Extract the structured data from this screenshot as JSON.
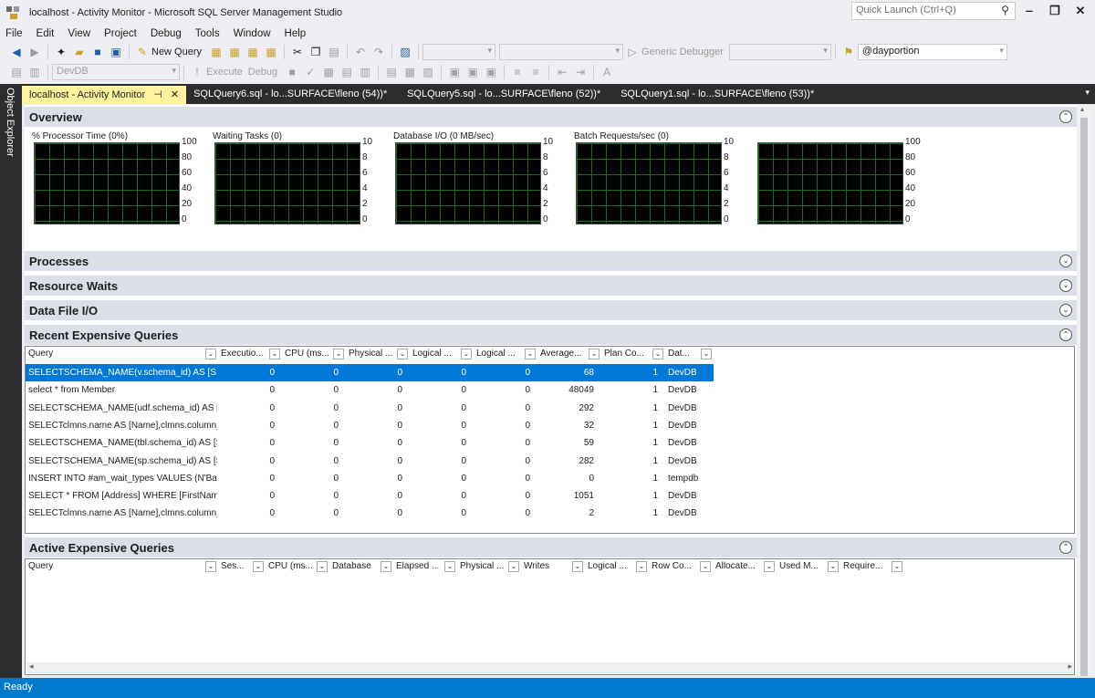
{
  "window": {
    "title": "localhost - Activity Monitor - Microsoft SQL Server Management Studio",
    "quick_launch_placeholder": "Quick Launch (Ctrl+Q)"
  },
  "menu": [
    "File",
    "Edit",
    "View",
    "Project",
    "Debug",
    "Tools",
    "Window",
    "Help"
  ],
  "toolbar1": {
    "new_query": "New Query",
    "generic_debugger": "Generic Debugger",
    "search_value": "@dayportion"
  },
  "toolbar2": {
    "database": "DevDB",
    "execute": "Execute",
    "debug": "Debug"
  },
  "left_rail": {
    "label": "Object Explorer"
  },
  "tabs": [
    {
      "label": "localhost - Activity Monitor",
      "active": true
    },
    {
      "label": "SQLQuery6.sql - lo...SURFACE\\fleno (54))*",
      "active": false
    },
    {
      "label": "SQLQuery5.sql - lo...SURFACE\\fleno (52))*",
      "active": false
    },
    {
      "label": "SQLQuery1.sql - lo...SURFACE\\fleno (53))*",
      "active": false
    }
  ],
  "sections": {
    "overview": "Overview",
    "processes": "Processes",
    "resource_waits": "Resource Waits",
    "data_file_io": "Data File I/O",
    "recent_expensive": "Recent Expensive Queries",
    "active_expensive": "Active Expensive Queries"
  },
  "graphs": [
    {
      "title": "% Processor Time (0%)",
      "ticks": [
        "100",
        "80",
        "60",
        "40",
        "20",
        "0"
      ]
    },
    {
      "title": "Waiting Tasks (0)",
      "ticks": [
        "10",
        "8",
        "6",
        "4",
        "2",
        "0"
      ]
    },
    {
      "title": "Database I/O (0 MB/sec)",
      "ticks": [
        "10",
        "8",
        "6",
        "4",
        "2",
        "0"
      ]
    },
    {
      "title": "Batch Requests/sec (0)",
      "ticks": [
        "10",
        "8",
        "6",
        "4",
        "2",
        "0"
      ]
    },
    {
      "title": "",
      "ticks": [
        "100",
        "80",
        "60",
        "40",
        "20",
        "0"
      ]
    }
  ],
  "recent_columns": [
    "Query",
    "Executio...",
    "CPU (ms...",
    "Physical ...",
    "Logical ...",
    "Logical ...",
    "Average...",
    "Plan Co...",
    "Dat..."
  ],
  "recent_rows": [
    [
      "SELECTSCHEMA_NAME(v.schema_id) AS [S...",
      "0",
      "0",
      "0",
      "0",
      "0",
      "68",
      "1",
      "DevDB"
    ],
    [
      "select * from Member",
      "0",
      "0",
      "0",
      "0",
      "0",
      "48049",
      "1",
      "DevDB"
    ],
    [
      "SELECTSCHEMA_NAME(udf.schema_id) AS [...",
      "0",
      "0",
      "0",
      "0",
      "0",
      "292",
      "1",
      "DevDB"
    ],
    [
      "SELECTclmns.name AS [Name],clmns.column_...",
      "0",
      "0",
      "0",
      "0",
      "0",
      "32",
      "1",
      "DevDB"
    ],
    [
      "SELECTSCHEMA_NAME(tbl.schema_id) AS [S...",
      "0",
      "0",
      "0",
      "0",
      "0",
      "59",
      "1",
      "DevDB"
    ],
    [
      "SELECTSCHEMA_NAME(sp.schema_id) AS [S...",
      "0",
      "0",
      "0",
      "0",
      "0",
      "282",
      "1",
      "DevDB"
    ],
    [
      "INSERT INTO #am_wait_types VALUES (N'Ba...",
      "0",
      "0",
      "0",
      "0",
      "0",
      "0",
      "1",
      "tempdb"
    ],
    [
      "SELECT * FROM [Address] WHERE [FirstNam...",
      "0",
      "0",
      "0",
      "0",
      "0",
      "1051",
      "1",
      "DevDB"
    ],
    [
      "SELECTclmns.name AS [Name],clmns.column_...",
      "0",
      "0",
      "0",
      "0",
      "0",
      "2",
      "1",
      "DevDB"
    ]
  ],
  "active_columns": [
    "Query",
    "Ses...",
    "CPU (ms...",
    "Database",
    "Elapsed ...",
    "Physical ...",
    "Writes",
    "Logical ...",
    "Row Co...",
    "Allocate...",
    "Used M...",
    "Require..."
  ],
  "status": {
    "text": "Ready"
  }
}
